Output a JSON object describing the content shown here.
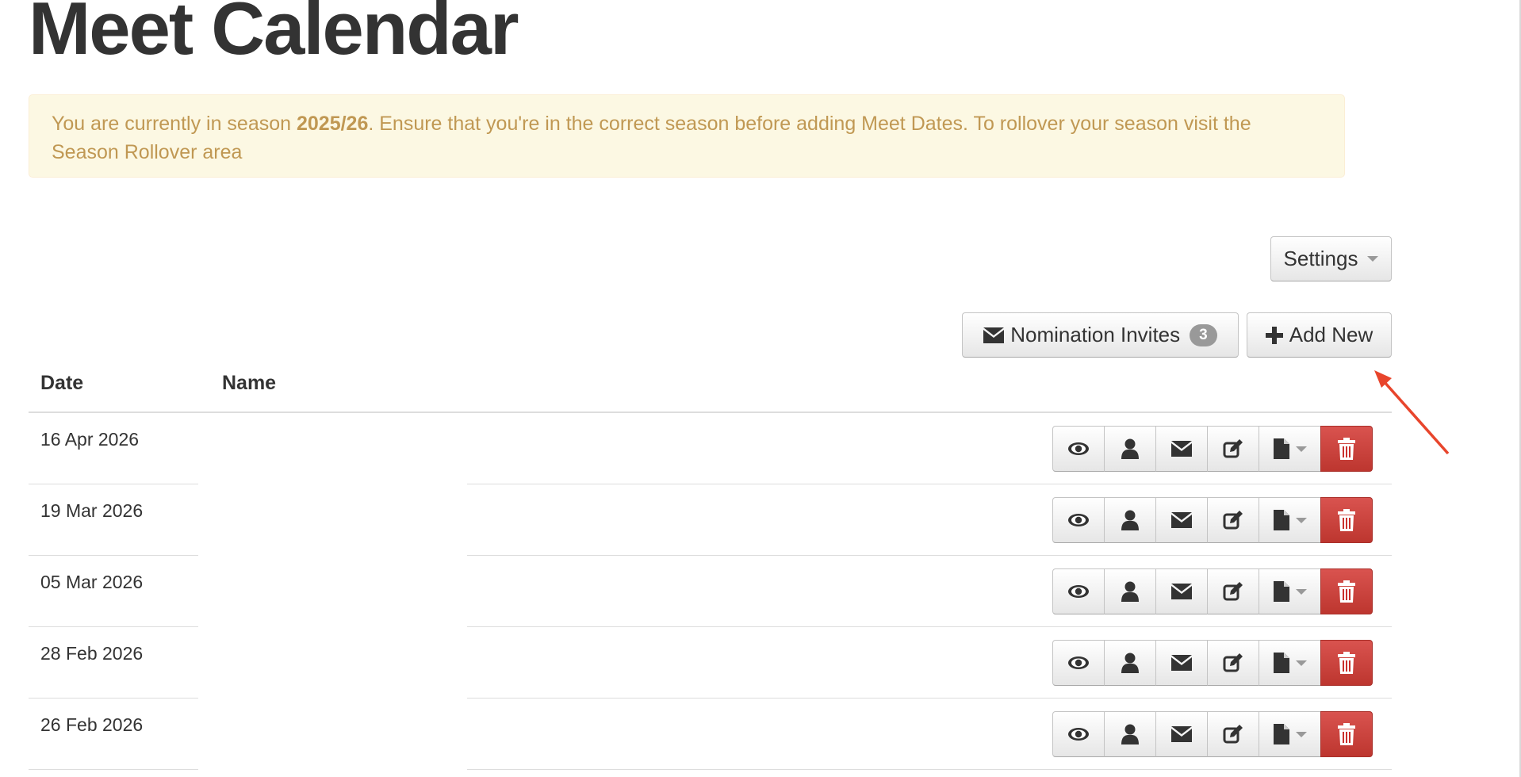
{
  "page": {
    "title": "Meet Calendar"
  },
  "alert": {
    "prefix": "You are currently in season ",
    "season": "2025/26",
    "suffix": ". Ensure that you're in the correct season before adding Meet Dates. To rollover your season visit the Season Rollover area"
  },
  "toolbar": {
    "settings_label": "Settings",
    "nomination_label": "Nomination Invites",
    "nomination_count": "3",
    "add_new_label": "Add New"
  },
  "table": {
    "headers": {
      "date": "Date",
      "name": "Name"
    },
    "rows": [
      {
        "date": "16 Apr 2026",
        "name": ""
      },
      {
        "date": "19 Mar 2026",
        "name": ""
      },
      {
        "date": "05 Mar 2026",
        "name": ""
      },
      {
        "date": "28 Feb 2026",
        "name": ""
      },
      {
        "date": "26 Feb 2026",
        "name": ""
      }
    ]
  },
  "icons": {
    "view": "eye-icon",
    "members": "user-icon",
    "email": "envelope-icon",
    "edit": "edit-icon",
    "file": "file-icon",
    "delete": "trash-icon",
    "annotation": "red-arrow"
  },
  "colors": {
    "alert_bg": "#fcf8e3",
    "alert_text": "#c09853",
    "danger": "#d9534f",
    "badge": "#999999",
    "annotation_arrow": "#e8452c"
  }
}
